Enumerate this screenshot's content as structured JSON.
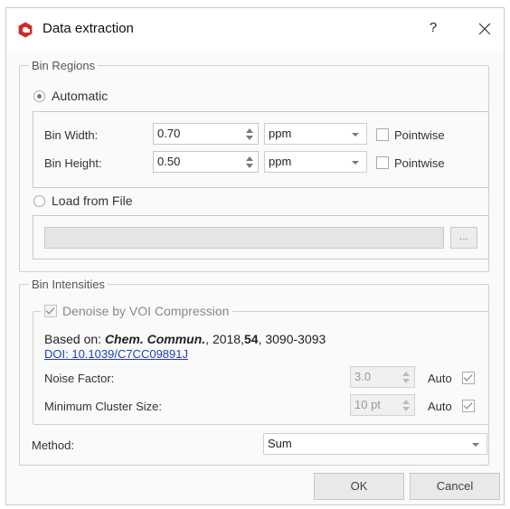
{
  "window": {
    "title": "Data extraction",
    "help_label": "?",
    "icon": "app-logo-icon",
    "accent": "#d0262b"
  },
  "bin_regions": {
    "legend": "Bin Regions",
    "automatic": {
      "label": "Automatic",
      "selected": true
    },
    "bin_width": {
      "label": "Bin Width:",
      "value": "0.70",
      "unit": "ppm",
      "pointwise_label": "Pointwise",
      "pointwise_checked": false
    },
    "bin_height": {
      "label": "Bin Height:",
      "value": "0.50",
      "unit": "ppm",
      "pointwise_label": "Pointwise",
      "pointwise_checked": false
    },
    "load_from_file": {
      "label": "Load from File",
      "selected": false,
      "path": "",
      "browse_label": "..."
    }
  },
  "bin_intensities": {
    "legend": "Bin Intensities",
    "denoise": {
      "label": "Denoise by VOI Compression",
      "checked": true
    },
    "reference": {
      "prefix": "Based on: ",
      "journal": "Chem. Commun.",
      "year_part": ", 2018,",
      "volume": "54",
      "pages": ", 3090-3093",
      "doi": "DOI: 10.1039/C7CC09891J"
    },
    "noise_factor": {
      "label": "Noise Factor:",
      "value": "3.0",
      "auto_label": "Auto",
      "auto_checked": true
    },
    "min_cluster": {
      "label": "Minimum Cluster Size:",
      "value": "10 pt",
      "auto_label": "Auto",
      "auto_checked": true
    },
    "method": {
      "label": "Method:",
      "value": "Sum"
    }
  },
  "buttons": {
    "ok": "OK",
    "cancel": "Cancel"
  }
}
